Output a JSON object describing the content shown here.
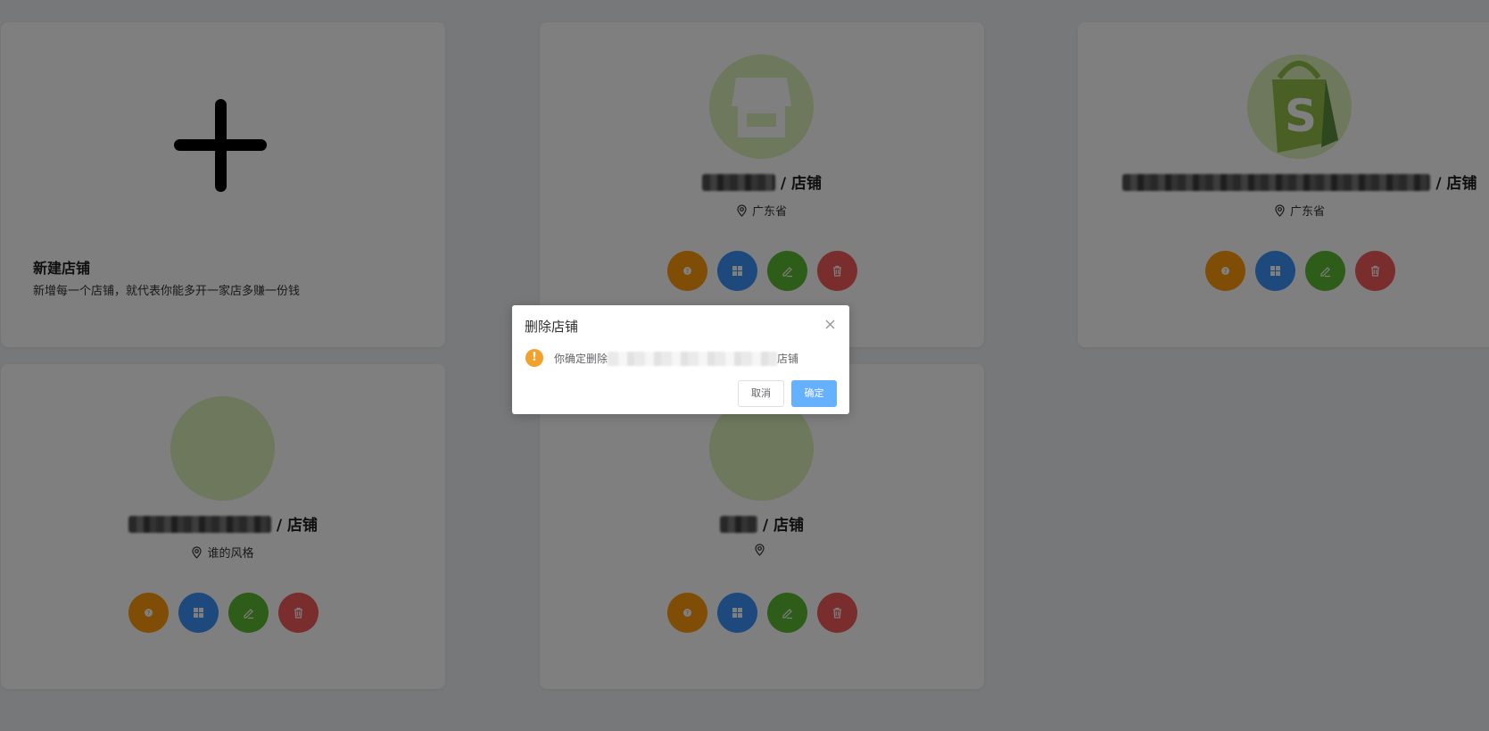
{
  "new_store_card": {
    "title": "新建店铺",
    "description": "新增每一个店铺，就代表你能多开一家店多赚一份钱"
  },
  "store_cards": [
    {
      "name_suffix": "/ 店铺",
      "location": "广东省",
      "logo": "storefront-icon"
    },
    {
      "name_suffix": "/ 店铺",
      "location": "广东省",
      "logo": "shopify-bag-logo"
    },
    {
      "name_suffix": "/ 店铺",
      "location": "谁的风格",
      "logo": ""
    },
    {
      "name_suffix": "/ 店铺",
      "location": "",
      "logo": ""
    }
  ],
  "action_buttons": [
    {
      "icon": "question-icon",
      "color": "#ff9a0a"
    },
    {
      "icon": "grid-icon",
      "color": "#3a93fa"
    },
    {
      "icon": "edit-icon",
      "color": "#5cb832"
    },
    {
      "icon": "trash-icon",
      "color": "#f45a5a"
    }
  ],
  "dialog": {
    "title": "删除店铺",
    "message_prefix": "你确定删除",
    "message_suffix": "店铺",
    "cancel_label": "取消",
    "confirm_label": "确定"
  },
  "colors": {
    "accent_primary": "#66b1ff",
    "warning": "#f2a12c",
    "avatar_bg": "#dbf0b9"
  }
}
